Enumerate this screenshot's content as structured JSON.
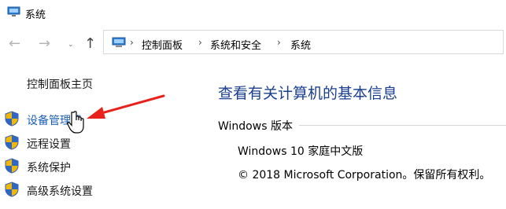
{
  "window": {
    "title": "系统"
  },
  "nav": {
    "back": "←",
    "forward": "→",
    "up": "↑"
  },
  "address": {
    "crumbs": [
      "控制面板",
      "系统和安全",
      "系统"
    ],
    "separator": "›"
  },
  "sidebar": {
    "home": "控制面板主页",
    "items": [
      {
        "label": "设备管理器"
      },
      {
        "label": "远程设置"
      },
      {
        "label": "系统保护"
      },
      {
        "label": "高级系统设置"
      }
    ]
  },
  "main": {
    "heading": "查看有关计算机的基本信息",
    "section": "Windows 版本",
    "edition": "Windows 10 家庭中文版",
    "copyright": "© 2018 Microsoft Corporation。保留所有权利。"
  },
  "colors": {
    "link": "#1a5fb4",
    "heading": "#1a3f8f",
    "annotation_arrow": "#e8221b"
  },
  "icons": [
    "computer-icon",
    "shield-icon",
    "hand-cursor-icon",
    "red-arrow-annotation"
  ]
}
